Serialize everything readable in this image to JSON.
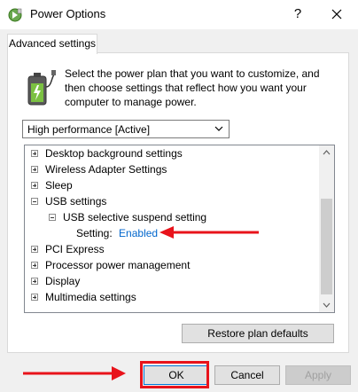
{
  "window": {
    "title": "Power Options",
    "help_glyph": "?"
  },
  "tab": {
    "label": "Advanced settings"
  },
  "description": "Select the power plan that you want to customize, and then choose settings that reflect how you want your computer to manage power.",
  "plan": {
    "selected": "High performance [Active]"
  },
  "tree": {
    "desktop_background": "Desktop background settings",
    "wireless_adapter": "Wireless Adapter Settings",
    "sleep": "Sleep",
    "usb_settings": "USB settings",
    "usb_selective_suspend": "USB selective suspend setting",
    "setting_label": "Setting:",
    "setting_value": "Enabled",
    "pci_express": "PCI Express",
    "processor_power": "Processor power management",
    "display": "Display",
    "multimedia": "Multimedia settings"
  },
  "buttons": {
    "restore": "Restore plan defaults",
    "ok": "OK",
    "cancel": "Cancel",
    "apply": "Apply"
  },
  "colors": {
    "link_blue": "#0066cc",
    "annotation_red": "#e8131b"
  },
  "icons": {
    "app": "power-options-icon",
    "battery": "battery-plug-icon",
    "close": "close-icon",
    "dropdown": "chevron-down-icon"
  }
}
